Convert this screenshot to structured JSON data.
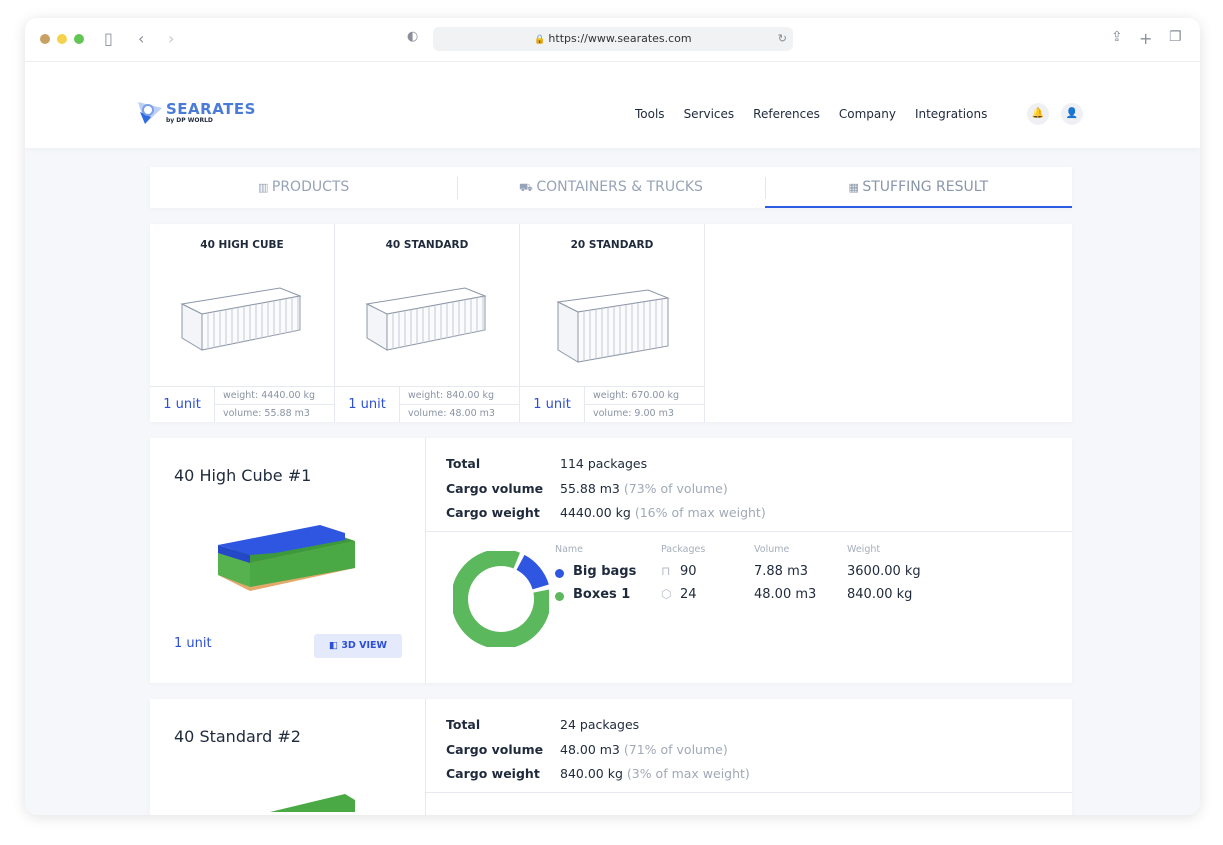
{
  "browser": {
    "url": "https://www.searates.com"
  },
  "header": {
    "logo": "SEARATES",
    "logo_sub": "by DP WORLD",
    "nav": [
      "Tools",
      "Services",
      "References",
      "Company",
      "Integrations"
    ]
  },
  "tabs": [
    {
      "label": "PRODUCTS"
    },
    {
      "label": "CONTAINERS & TRUCKS"
    },
    {
      "label": "STUFFING RESULT",
      "active": true
    }
  ],
  "containers": [
    {
      "name": "40 HIGH CUBE",
      "units": "1 unit",
      "weight": "weight: 4440.00 kg",
      "volume": "volume: 55.88 m3"
    },
    {
      "name": "40 STANDARD",
      "units": "1 unit",
      "weight": "weight: 840.00 kg",
      "volume": "volume: 48.00 m3"
    },
    {
      "name": "20 STANDARD",
      "units": "1 unit",
      "weight": "weight: 670.00 kg",
      "volume": "volume: 9.00 m3"
    }
  ],
  "results": [
    {
      "title": "40 High Cube #1",
      "units": "1 unit",
      "view_button": "3D VIEW",
      "total_label": "Total",
      "total": "114 packages",
      "volume_label": "Cargo volume",
      "volume": "55.88 m3",
      "volume_pct": "(73% of volume)",
      "weight_label": "Cargo weight",
      "weight": "4440.00 kg",
      "weight_pct": "(16% of max weight)",
      "columns": [
        "Name",
        "Packages",
        "Volume",
        "Weight"
      ],
      "items": [
        {
          "name": "Big bags",
          "packages": "90",
          "volume": "7.88 m3",
          "weight": "3600.00 kg",
          "color": "#2f56e0",
          "icon": "bag-icon",
          "share": 7.88
        },
        {
          "name": "Boxes 1",
          "packages": "24",
          "volume": "48.00 m3",
          "weight": "840.00 kg",
          "color": "#5cb85c",
          "icon": "box-icon",
          "share": 48
        }
      ]
    },
    {
      "title": "40 Standard #2",
      "total_label": "Total",
      "total": "24 packages",
      "volume_label": "Cargo volume",
      "volume": "48.00 m3",
      "volume_pct": "(71% of volume)",
      "weight_label": "Cargo weight",
      "weight": "840.00 kg",
      "weight_pct": "(3% of max weight)"
    }
  ]
}
